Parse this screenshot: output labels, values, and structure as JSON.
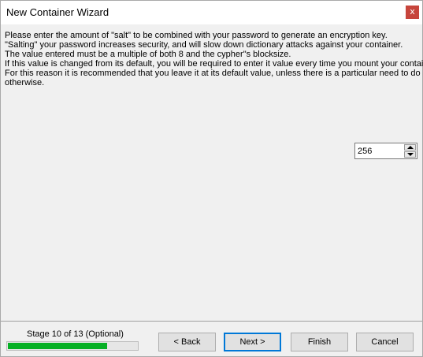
{
  "window": {
    "title": "New Container Wizard",
    "close_glyph": "x"
  },
  "description": {
    "lines": [
      "Please enter the amount of \"salt\" to be combined with your password to generate an encryption key.",
      "\"Salting\" your password increases security, and will slow down dictionary attacks against your container.",
      "The value entered must be a multiple of both 8 and the cypher\"s blocksize.",
      "If this value is changed from its default, you will be required to enter it value every time you mount your container.",
      "For this reason it is recommended that you leave it at its default value, unless there is a particular need to do",
      "otherwise."
    ]
  },
  "salt": {
    "value": "256"
  },
  "footer": {
    "stage_label": "Stage 10 of 13 (Optional)",
    "progress_fraction": 0.7692
  },
  "buttons": {
    "back": "< Back",
    "next": "Next >",
    "finish": "Finish",
    "cancel": "Cancel"
  },
  "colors": {
    "close_button": "#c7453c",
    "progress_fill": "#06b025",
    "default_button_border": "#0078d7"
  },
  "icons": {
    "close": "close-icon",
    "spin_up": "arrow-up-icon",
    "spin_down": "arrow-down-icon"
  }
}
